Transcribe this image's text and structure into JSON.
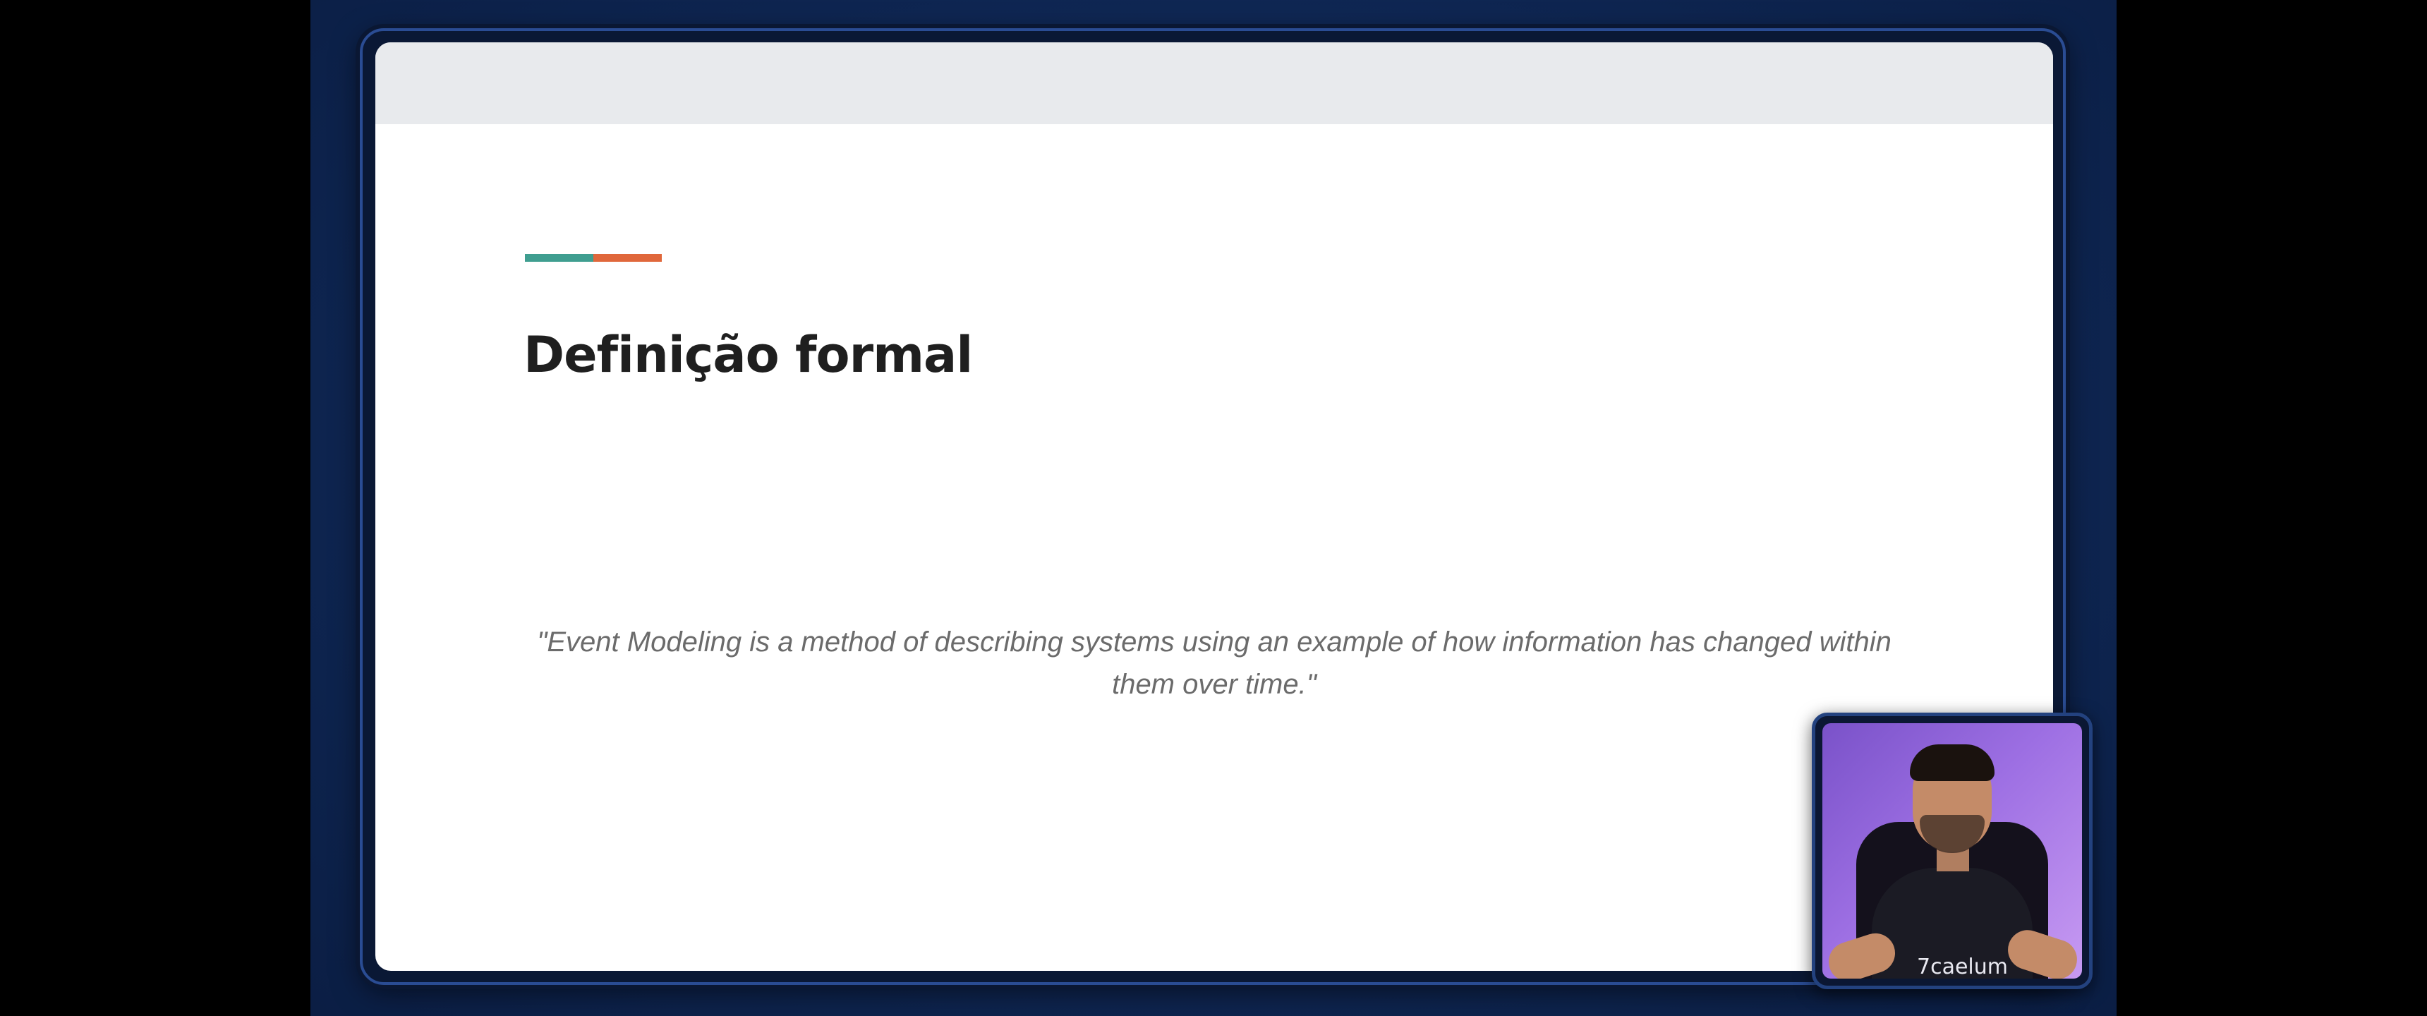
{
  "slide": {
    "title": "Definição formal",
    "quote": "\"Event Modeling is a method of describing systems using an example of how information has changed within them over time.\"",
    "accent_colors": [
      "#3f9e90",
      "#e0673b"
    ]
  },
  "webcam": {
    "shirt_text": "7caelum"
  },
  "colors": {
    "backdrop": "#0f2754",
    "frame_border": "#2a4c93",
    "slide_background": "#ffffff",
    "header_bar": "#e8eaed",
    "title_text": "#1f1f1f",
    "quote_text": "#6b6b6b",
    "webcam_background": "#9d6fe3"
  }
}
